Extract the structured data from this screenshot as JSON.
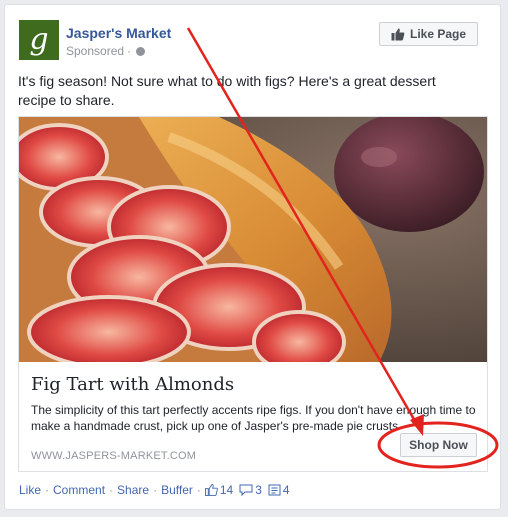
{
  "post": {
    "page_name": "Jasper's Market",
    "logo_letter": "g",
    "sponsored": "Sponsored",
    "separator": "·",
    "like_page_label": "Like Page",
    "text": "It's fig season! Not sure what to do with figs? Here's a great dessert recipe to share."
  },
  "ad": {
    "title": "Fig Tart with Almonds",
    "description": "The simplicity of this tart perfectly accents ripe figs. If you don't have enough time to make a handmade crust, pick up one of Jasper's pre-made pie crusts",
    "domain": "WWW.JASPERS-MARKET.COM",
    "cta_label": "Shop Now"
  },
  "actions": {
    "like": "Like",
    "comment": "Comment",
    "share": "Share",
    "buffer": "Buffer",
    "dot": "·",
    "like_count": "14",
    "comment_count": "3",
    "share_count": "4"
  },
  "colors": {
    "link": "#365899",
    "annotation_red": "#e3231e",
    "logo_green": "#3f6b1f"
  },
  "icons": [
    "thumbs-up-icon",
    "globe-icon",
    "comment-icon",
    "share-icon"
  ]
}
